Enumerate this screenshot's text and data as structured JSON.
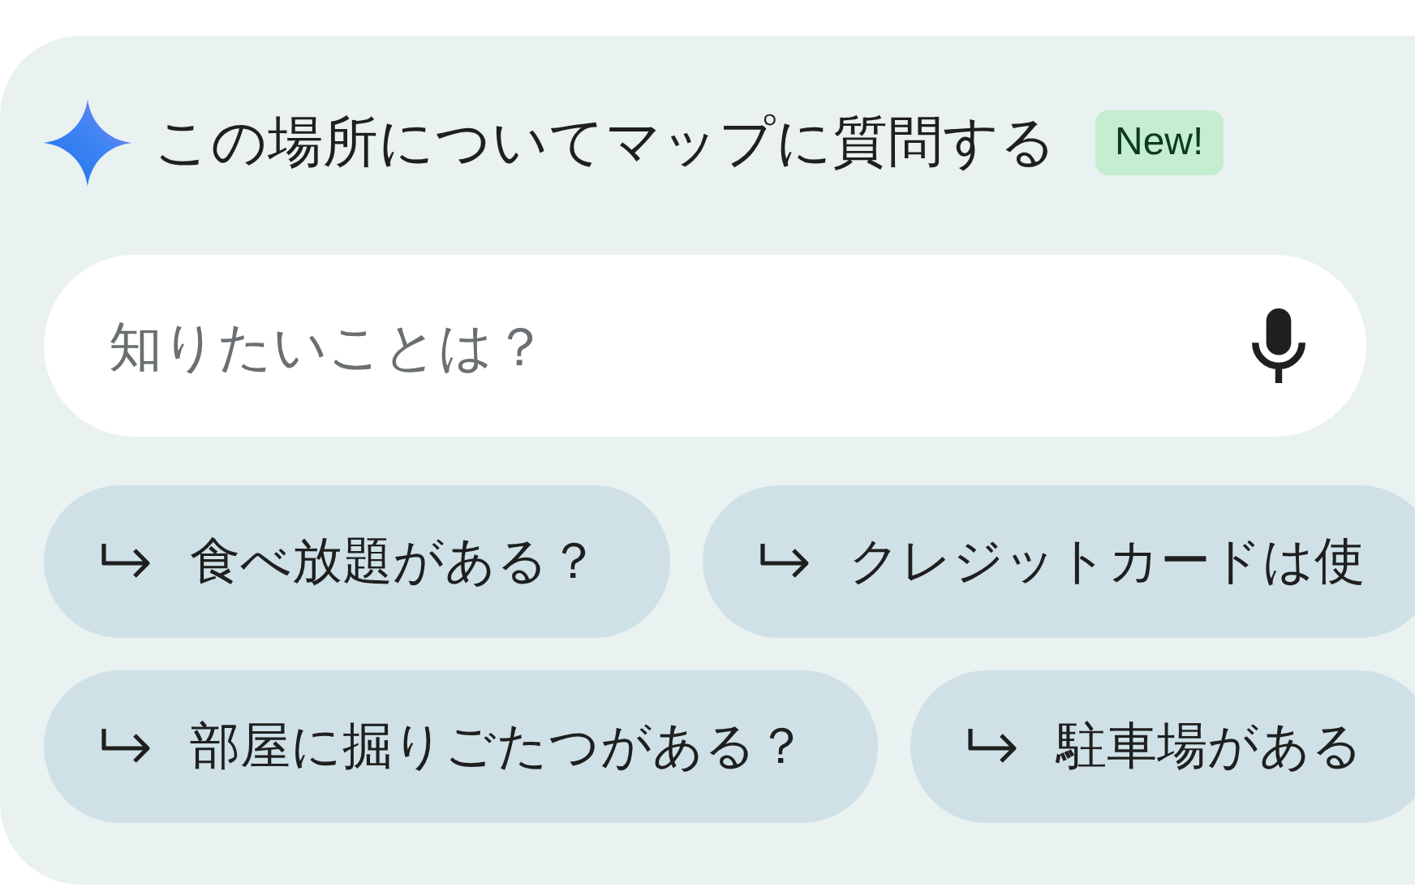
{
  "header": {
    "title": "この場所についてマップに質問する",
    "badge": "New!"
  },
  "search": {
    "placeholder": "知りたいことは？"
  },
  "suggestion_rows": [
    {
      "chips": [
        {
          "label": "食べ放題がある？"
        },
        {
          "label": "クレジットカードは使"
        }
      ]
    },
    {
      "chips": [
        {
          "label": "部屋に掘りごたつがある？"
        },
        {
          "label": "駐車場がある"
        }
      ]
    }
  ]
}
